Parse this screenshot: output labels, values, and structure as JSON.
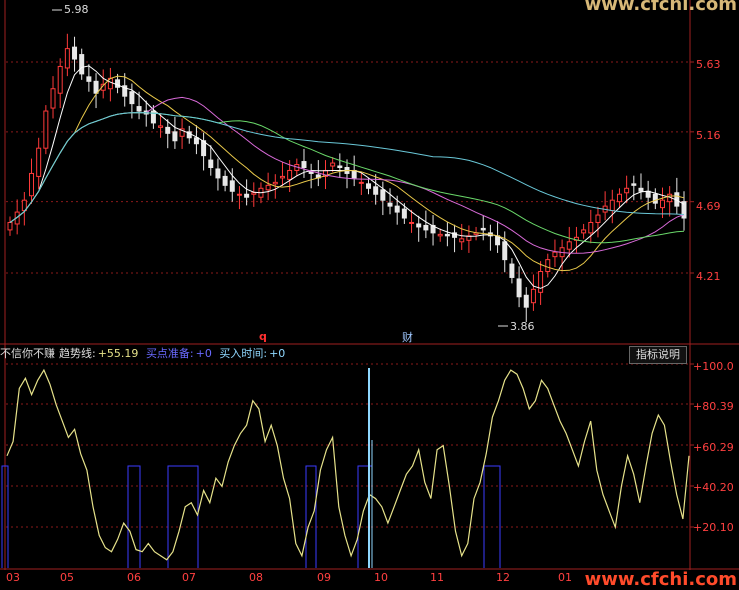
{
  "price_panel": {
    "y_ticks": [
      "5.63",
      "5.16",
      "4.69",
      "4.21"
    ],
    "high_label": "5.98",
    "low_label": "3.86",
    "marker_q": "q",
    "marker_cai": "财"
  },
  "indicator": {
    "name": "不信你不赚",
    "trend_label": "趋势线:",
    "trend_value": "+55.19",
    "buy_prep_label": "买点准备:",
    "buy_prep_value": "+0",
    "buy_time_label": "买入时间:",
    "buy_time_value": "+0",
    "help_button": "指标说明",
    "y_ticks": [
      "+100.0",
      "+80.39",
      "+60.29",
      "+40.20",
      "+20.10"
    ]
  },
  "x_axis": {
    "months": [
      "03",
      "05",
      "06",
      "07",
      "08",
      "09",
      "10",
      "11",
      "12",
      "01"
    ]
  },
  "watermark": {
    "top": "www.cfchi.com",
    "bottom": "www.cfchi.com"
  },
  "colors": {
    "grid": "#8a1a1a",
    "axis": "#a02020",
    "up": "#ff3a3a",
    "down": "#e8e8e8",
    "trend": "#e6e28a",
    "signal": "#3b3bff",
    "buy_time": "#8fd8ff",
    "ma5": "#ffffff",
    "ma10": "#e8c84a",
    "ma20": "#d86ad8",
    "ma30": "#6ad86a",
    "ma60": "#6ac8d8"
  },
  "chart_data": [
    {
      "type": "candlestick",
      "title": "",
      "ylim": [
        3.86,
        5.98
      ],
      "y_ticks": [
        5.63,
        5.16,
        4.69,
        4.21
      ],
      "annotations": [
        "5.98",
        "3.86"
      ],
      "close": [
        4.55,
        4.62,
        4.7,
        4.88,
        5.05,
        5.3,
        5.45,
        5.6,
        5.72,
        5.65,
        5.55,
        5.5,
        5.42,
        5.48,
        5.52,
        5.46,
        5.4,
        5.35,
        5.3,
        5.28,
        5.22,
        5.2,
        5.15,
        5.1,
        5.18,
        5.12,
        5.08,
        5.0,
        4.92,
        4.85,
        4.8,
        4.76,
        4.74,
        4.72,
        4.75,
        4.78,
        4.8,
        4.82,
        4.86,
        4.9,
        4.94,
        4.92,
        4.88,
        4.85,
        4.9,
        4.95,
        4.92,
        4.88,
        4.85,
        4.82,
        4.78,
        4.74,
        4.7,
        4.66,
        4.62,
        4.58,
        4.55,
        4.52,
        4.5,
        4.48,
        4.47,
        4.46,
        4.45,
        4.44,
        4.46,
        4.48,
        4.5,
        4.46,
        4.4,
        4.3,
        4.18,
        4.05,
        3.98,
        4.1,
        4.22,
        4.3,
        4.35,
        4.38,
        4.42,
        4.45,
        4.5,
        4.55,
        4.6,
        4.66,
        4.7,
        4.74,
        4.78,
        4.8,
        4.76,
        4.72,
        4.68,
        4.7,
        4.74,
        4.66,
        4.58
      ]
    },
    {
      "type": "line",
      "title": "不信你不赚",
      "ylim": [
        0,
        100
      ],
      "y_ticks": [
        100.0,
        80.39,
        60.29,
        40.2,
        20.1
      ],
      "series": [
        {
          "name": "趋势线",
          "values": [
            55,
            62,
            88,
            93,
            85,
            92,
            97,
            90,
            80,
            72,
            64,
            68,
            56,
            48,
            30,
            16,
            10,
            8,
            14,
            22,
            18,
            9,
            8,
            12,
            8,
            6,
            4,
            8,
            18,
            30,
            32,
            26,
            38,
            32,
            44,
            40,
            52,
            60,
            66,
            70,
            82,
            78,
            62,
            70,
            60,
            44,
            34,
            12,
            6,
            20,
            28,
            48,
            58,
            64,
            30,
            16,
            6,
            14,
            28,
            36,
            34,
            30,
            22,
            30,
            38,
            46,
            50,
            58,
            42,
            34,
            58,
            60,
            40,
            18,
            6,
            12,
            34,
            42,
            56,
            74,
            82,
            92,
            97,
            95,
            88,
            78,
            82,
            92,
            88,
            80,
            72,
            66,
            58,
            50,
            62,
            72,
            48,
            36,
            28,
            20,
            40,
            55,
            46,
            32,
            50,
            66,
            75,
            70,
            52,
            36,
            24,
            55
          ]
        },
        {
          "name": "买点准备",
          "values": [
            0
          ]
        },
        {
          "name": "买入时间",
          "values": [
            0
          ]
        }
      ]
    }
  ]
}
